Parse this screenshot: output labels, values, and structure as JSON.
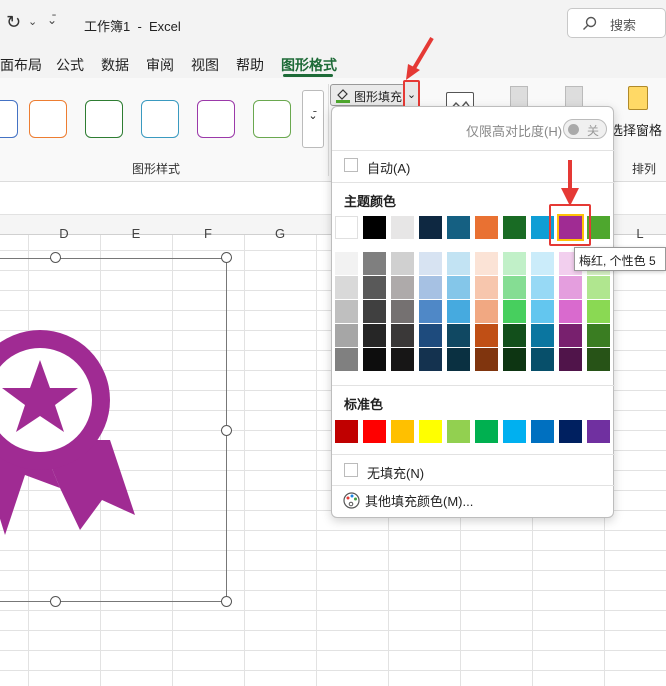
{
  "titlebar": {
    "title": "工作簿1  -  Excel",
    "search_placeholder": "搜索"
  },
  "menu": {
    "tabs": [
      "面布局",
      "公式",
      "数据",
      "审阅",
      "视图",
      "帮助",
      "图形格式"
    ],
    "active": "图形格式"
  },
  "ribbon": {
    "shape_styles_label": "图形样式",
    "shape_style_colors": [
      "#4472c4",
      "#ed7d31",
      "#2e7d32",
      "#3a9ac0",
      "#9b39a9",
      "#6aa84f"
    ],
    "shape_fill_label": "图形填充",
    "selection_pane_label": "选择窗格",
    "arrange_label": "排列"
  },
  "columns": [
    "D",
    "E",
    "F",
    "G",
    "L"
  ],
  "dropdown": {
    "high_contrast_label": "仅限高对比度(H)",
    "toggle_state": "关",
    "auto_label": "自动(A)",
    "theme_colors_title": "主题颜色",
    "theme_colors": [
      "#ffffff",
      "#000000",
      "#e7e6e6",
      "#0e2841",
      "#156082",
      "#e97132",
      "#196b24",
      "#0f9ed5",
      "#a02b93",
      "#4ea72e"
    ],
    "tints": [
      [
        "#f2f2f2",
        "#7f7f7f",
        "#d0d0d0",
        "#d7e3f2",
        "#c2e3f3",
        "#fbe3d6",
        "#c1f0c8",
        "#cbecfa",
        "#f2cfee",
        "#d7f2c5"
      ],
      [
        "#d9d9d9",
        "#595959",
        "#aeaaaa",
        "#a6c1e3",
        "#84c6e9",
        "#f7c6ad",
        "#85dd93",
        "#97d9f5",
        "#e49ede",
        "#b0e68f"
      ],
      [
        "#bfbfbf",
        "#404040",
        "#757171",
        "#4f88c7",
        "#46aadf",
        "#f1a882",
        "#47cf5e",
        "#63c6ef",
        "#d96ace",
        "#8ad953"
      ],
      [
        "#a6a6a6",
        "#262626",
        "#3a3838",
        "#1e4b7d",
        "#104862",
        "#c04f15",
        "#124f1b",
        "#0b76a0",
        "#78206e",
        "#3a7d22"
      ],
      [
        "#808080",
        "#0d0d0d",
        "#171616",
        "#14324f",
        "#0a3041",
        "#80350e",
        "#0d3512",
        "#074f6a",
        "#50144a",
        "#275317"
      ]
    ],
    "standard_title": "标准色",
    "standard_colors": [
      "#c00000",
      "#ff0000",
      "#ffc000",
      "#ffff00",
      "#92d050",
      "#00b050",
      "#00b0f0",
      "#0070c0",
      "#002060",
      "#7030a0"
    ],
    "no_fill_label": "无填充(N)",
    "more_colors_label": "其他填充颜色(M)..."
  },
  "tooltip": "梅红, 个性色 5",
  "accent": "#a02b93"
}
